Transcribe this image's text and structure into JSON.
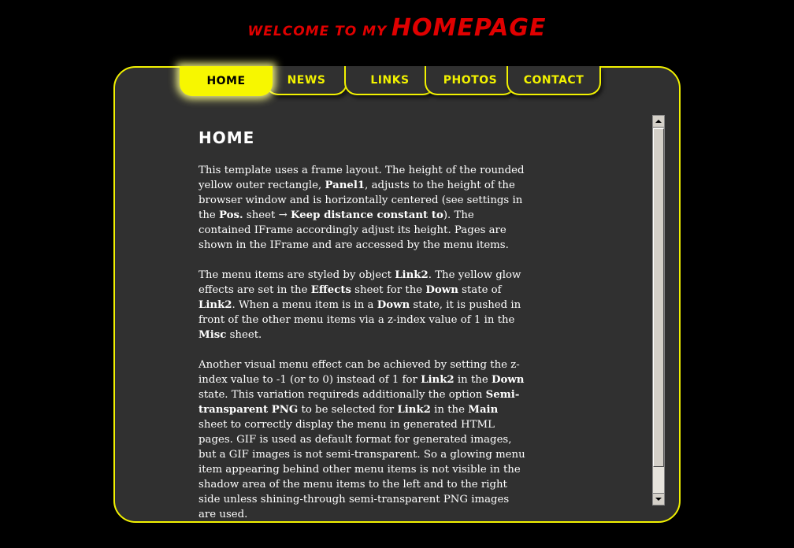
{
  "header": {
    "title_small": "WELCOME TO MY",
    "title_big": "HOMEPAGE"
  },
  "nav": {
    "items": [
      {
        "label": "HOME",
        "active": true
      },
      {
        "label": "NEWS"
      },
      {
        "label": "LINKS"
      },
      {
        "label": "PHOTOS"
      },
      {
        "label": "CONTACT"
      }
    ]
  },
  "content": {
    "heading": "HOME",
    "paragraphs": [
      [
        {
          "t": "This template uses a frame layout. The height of the rounded yellow outer rectangle, "
        },
        {
          "t": "Panel1",
          "b": true
        },
        {
          "t": ", adjusts to the height of the browser window and is horizontally centered (see settings in the "
        },
        {
          "t": "Pos.",
          "b": true
        },
        {
          "t": " sheet → "
        },
        {
          "t": "Keep distance constant to",
          "b": true
        },
        {
          "t": "). The contained IFrame accordingly adjust its height. Pages are shown in the IFrame and are accessed by the menu items."
        }
      ],
      [
        {
          "t": "The menu items are styled by object "
        },
        {
          "t": "Link2",
          "b": true
        },
        {
          "t": ". The yellow glow effects are set in the "
        },
        {
          "t": "Effects",
          "b": true
        },
        {
          "t": " sheet for the "
        },
        {
          "t": "Down",
          "b": true
        },
        {
          "t": " state of "
        },
        {
          "t": "Link2",
          "b": true
        },
        {
          "t": ". When a menu item is in a "
        },
        {
          "t": "Down",
          "b": true
        },
        {
          "t": " state, it is pushed in front of the other menu items via a z-index value of 1 in the "
        },
        {
          "t": "Misc",
          "b": true
        },
        {
          "t": " sheet."
        }
      ],
      [
        {
          "t": "Another visual menu effect can be achieved by setting the z-index value to -1 (or to 0) instead of 1 for "
        },
        {
          "t": "Link2",
          "b": true
        },
        {
          "t": " in the "
        },
        {
          "t": "Down",
          "b": true
        },
        {
          "t": " state. This variation requireds additionally the option "
        },
        {
          "t": "Semi-transparent PNG",
          "b": true
        },
        {
          "t": " to be selected for "
        },
        {
          "t": "Link2",
          "b": true
        },
        {
          "t": " in the "
        },
        {
          "t": "Main",
          "b": true
        },
        {
          "t": " sheet to correctly display the menu in generated HTML pages. GIF is used as default format for generated images, but a GIF images is not semi-transparent. So a glowing menu item appearing behind other menu items is not visible in the shadow area of the menu items to the left and to the right side unless shining-through semi-transparent PNG images are used."
        }
      ]
    ]
  },
  "scrollbar": {
    "up_icon": "scroll-up-arrow",
    "down_icon": "scroll-down-arrow"
  }
}
